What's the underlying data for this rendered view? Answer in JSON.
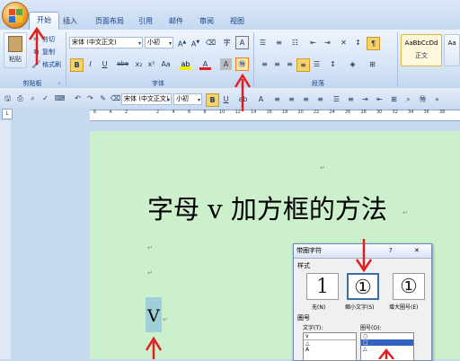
{
  "tabs": [
    "开始",
    "插入",
    "页面布局",
    "引用",
    "邮件",
    "审阅",
    "视图"
  ],
  "clipboard": {
    "paste": "粘贴",
    "cut": "剪切",
    "copy": "复制",
    "format_painter": "格式刷",
    "group": "剪贴板"
  },
  "font": {
    "name": "宋体 (中文正文)",
    "size": "小初",
    "group": "字体",
    "enclose_char": "㊕",
    "wen": "A"
  },
  "paragraph": {
    "group": "段落"
  },
  "styles": {
    "preview": "AaBbCcDd",
    "name": "正文"
  },
  "format_bar": {
    "font": "宋体 (中文正文)",
    "size": "小初"
  },
  "ruler_ticks": [
    "6",
    "4",
    "2",
    "",
    "2",
    "4",
    "6",
    "8",
    "10",
    "12",
    "14",
    "16",
    "18",
    "20",
    "22",
    "24",
    "26",
    "28",
    "30",
    "32",
    "34",
    "36",
    "38"
  ],
  "document": {
    "heading": "字母 v 加方框的方法",
    "selected_char": "V",
    "para_mark": "↵"
  },
  "dialog": {
    "title": "带圈字符",
    "help": "?",
    "close": "✕",
    "style_label": "样式",
    "styles": [
      {
        "label": "无(N)",
        "glyph": "1"
      },
      {
        "label": "缩小文字(S)",
        "glyph": "①"
      },
      {
        "label": "增大圈号(E)",
        "glyph": "①"
      }
    ],
    "circle_no_label": "圈号",
    "text_label": "文字(T):",
    "text_value": "v",
    "text_list": [
      "v",
      "△",
      "A"
    ],
    "circle_label": "圈号(O):",
    "circle_list": [
      "○",
      "□",
      "△"
    ]
  },
  "colors": {
    "arrow": "#e02020",
    "doc_bg": "#ccf0cc",
    "highlight": "#9fd0d9"
  }
}
